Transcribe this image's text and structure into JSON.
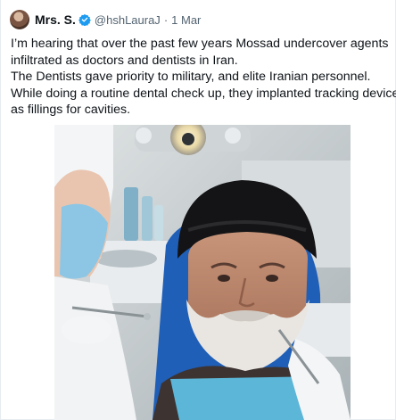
{
  "author": {
    "display_name": "Mrs. S.",
    "handle": "@hshLauraJ",
    "separator": "·",
    "timestamp": "1 Mar",
    "verified_icon": "verified-badge-icon",
    "avatar_icon": "avatar"
  },
  "tweet": {
    "lines": [
      "I’m hearing that over the past few years Mossad undercover agents",
      "infiltrated as doctors and dentists  in Iran.",
      "The Dentists gave priority to military, and elite Iranian personnel.",
      "While doing a routine dental check up, they implanted tracking devices",
      "as fillings for cavities."
    ]
  },
  "media": {
    "type": "photo",
    "subject": "man with white beard and black turban in dentist chair, dentist with mask and gloves holding tools"
  },
  "colors": {
    "text": "#0f1419",
    "secondary": "#536471",
    "verified": "#1d9bf0"
  }
}
